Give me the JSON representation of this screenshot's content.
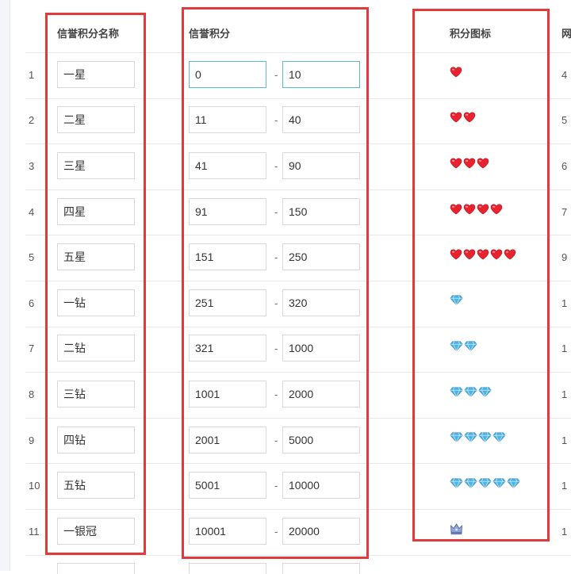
{
  "headers": {
    "name": "信誉积分名称",
    "score": "信誉积分",
    "icon": "积分图标",
    "cutoff": "网"
  },
  "separator": "-",
  "rows": [
    {
      "num": "1",
      "name": "一星",
      "min": "0",
      "max": "10",
      "icon_type": "heart",
      "icon_count": 1,
      "cutoff": "4"
    },
    {
      "num": "2",
      "name": "二星",
      "min": "11",
      "max": "40",
      "icon_type": "heart",
      "icon_count": 2,
      "cutoff": "5"
    },
    {
      "num": "3",
      "name": "三星",
      "min": "41",
      "max": "90",
      "icon_type": "heart",
      "icon_count": 3,
      "cutoff": "6"
    },
    {
      "num": "4",
      "name": "四星",
      "min": "91",
      "max": "150",
      "icon_type": "heart",
      "icon_count": 4,
      "cutoff": "7"
    },
    {
      "num": "5",
      "name": "五星",
      "min": "151",
      "max": "250",
      "icon_type": "heart",
      "icon_count": 5,
      "cutoff": "9"
    },
    {
      "num": "6",
      "name": "一钻",
      "min": "251",
      "max": "320",
      "icon_type": "diamond",
      "icon_count": 1,
      "cutoff": "1"
    },
    {
      "num": "7",
      "name": "二钻",
      "min": "321",
      "max": "1000",
      "icon_type": "diamond",
      "icon_count": 2,
      "cutoff": "1"
    },
    {
      "num": "8",
      "name": "三钻",
      "min": "1001",
      "max": "2000",
      "icon_type": "diamond",
      "icon_count": 3,
      "cutoff": "1"
    },
    {
      "num": "9",
      "name": "四钻",
      "min": "2001",
      "max": "5000",
      "icon_type": "diamond",
      "icon_count": 4,
      "cutoff": "1"
    },
    {
      "num": "10",
      "name": "五钻",
      "min": "5001",
      "max": "10000",
      "icon_type": "diamond",
      "icon_count": 5,
      "cutoff": "1"
    },
    {
      "num": "11",
      "name": "一银冠",
      "min": "10001",
      "max": "20000",
      "icon_type": "crown",
      "icon_count": 1,
      "cutoff": "1"
    }
  ],
  "colors": {
    "highlight_border": "#e03a3a",
    "focus_border": "#5bbfc9",
    "heart": "#e8232f",
    "diamond": "#4fb3e6"
  }
}
